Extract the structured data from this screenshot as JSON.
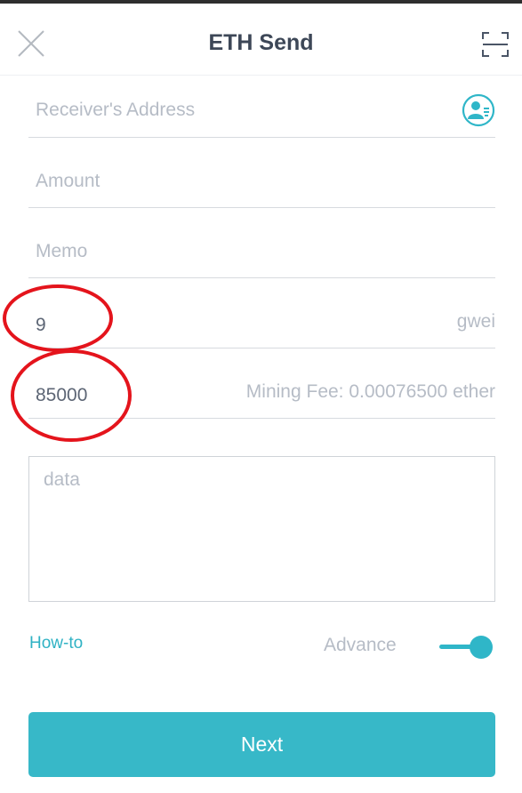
{
  "header": {
    "title": "ETH Send",
    "close_icon": "close-icon",
    "scan_icon": "scan-icon"
  },
  "form": {
    "receiver": {
      "placeholder": "Receiver's Address",
      "value": "",
      "icon": "contact-book-icon"
    },
    "amount": {
      "placeholder": "Amount",
      "value": ""
    },
    "memo": {
      "placeholder": "Memo",
      "value": ""
    },
    "gas_price": {
      "value": "9",
      "unit": "gwei"
    },
    "gas_limit": {
      "value": "85000",
      "fee_text": "Mining Fee: 0.00076500 ether"
    },
    "data": {
      "placeholder": "data",
      "value": ""
    }
  },
  "footer": {
    "howto_label": "How-to",
    "advance_label": "Advance",
    "advance_enabled": true
  },
  "next_label": "Next",
  "colors": {
    "accent": "#37b8c8",
    "annotation": "#e4141c",
    "title": "#3d4757",
    "placeholder": "#b6bcc6"
  }
}
